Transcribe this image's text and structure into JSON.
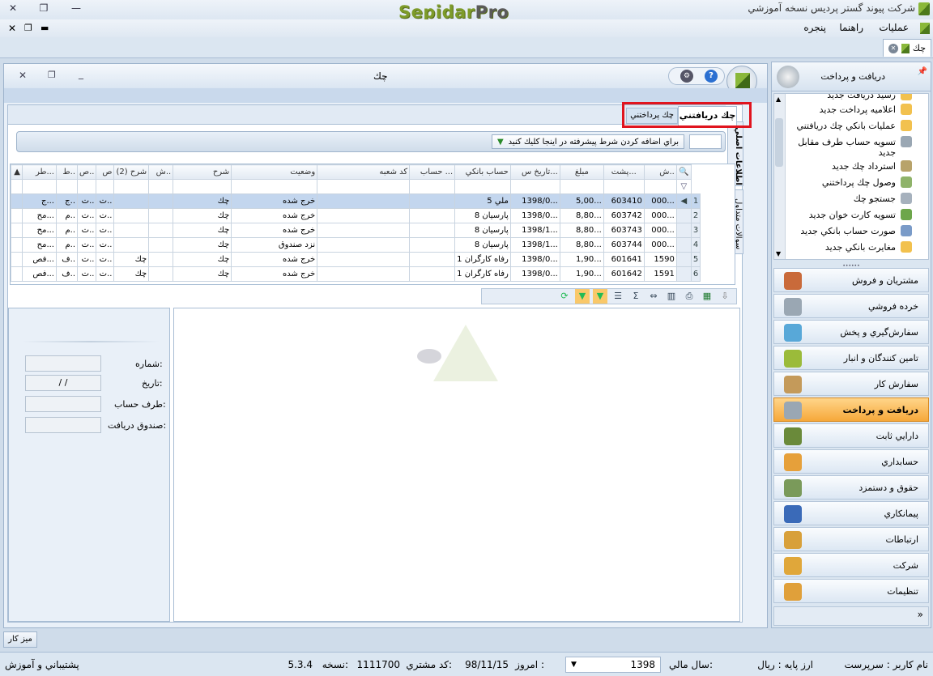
{
  "app": {
    "title": "شرکت پيوند گستر پرديس نسخه آموزشي",
    "logo_main": "Sepidar",
    "logo_pro": "Pro"
  },
  "menu": {
    "items": [
      "عمليات",
      "راهنما",
      "پنجره"
    ]
  },
  "doc_tab": {
    "label": "چك"
  },
  "window": {
    "title": "چك"
  },
  "tabs": {
    "received": "چك دريافتني",
    "payable": "چك پرداختني"
  },
  "side_tabs": [
    "اطلاعات اصلي",
    "سوالات متداول"
  ],
  "filter": {
    "hint": "براي اضافه كردن شرط پيشرفته در اينجا كليك كنيد"
  },
  "grid": {
    "columns": [
      "ش..",
      "پشت...",
      "مبلغ",
      "تاريخ س...",
      "حساب بانكي",
      "حساب ...",
      "كد شعبه",
      "وضعيت",
      "شرح",
      "ش..",
      "شرح (2)",
      "ص",
      "ص..",
      "ط..",
      "طر..."
    ],
    "rows": [
      [
        "1",
        "000...",
        "603410",
        "5,00...",
        "1398/0...",
        "ملي  5",
        "",
        "",
        "خرج شده",
        "چك",
        "",
        "",
        "ت..",
        "ت..",
        "ج..",
        "ج..."
      ],
      [
        "2",
        "000...",
        "603742",
        "8,80...",
        "1398/0...",
        "پارسيان  8",
        "",
        "",
        "خرج شده",
        "چك",
        "",
        "",
        "ت..",
        "ت..",
        "م..",
        "مح..."
      ],
      [
        "3",
        "000...",
        "603743",
        "8,80...",
        "1398/1...",
        "پارسيان  8",
        "",
        "",
        "خرج شده",
        "چك",
        "",
        "",
        "ت..",
        "ت..",
        "م..",
        "مح..."
      ],
      [
        "4",
        "000...",
        "603744",
        "8,80...",
        "1398/1...",
        "پارسيان  8",
        "",
        "",
        "نزد صندوق",
        "چك",
        "",
        "",
        "ت..",
        "ت..",
        "م..",
        "مح..."
      ],
      [
        "5",
        "1590",
        "601641",
        "1,90...",
        "1398/0...",
        "رفاه كارگران  1",
        "",
        "",
        "خرج شده",
        "چك",
        "",
        "چك",
        "ت..",
        "ت..",
        "ف..",
        "فص..."
      ],
      [
        "6",
        "1591",
        "601642",
        "1,90...",
        "1398/0...",
        "رفاه كارگران  1",
        "",
        "",
        "خرج شده",
        "چك",
        "",
        "چك",
        "ت..",
        "ت..",
        "ف..",
        "فص..."
      ]
    ]
  },
  "detail": {
    "number_label": "شماره:",
    "date_label": "تاريخ:",
    "date_value": "/  /",
    "party_label": "طرف حساب:",
    "box_label": "صندوق دريافت:"
  },
  "nav": {
    "header": "دريافت و پرداخت",
    "sub_items": [
      "رسيد دريافت جديد",
      "اعلاميه پرداخت جديد",
      "عمليات بانكي چك دريافتني",
      "تسويه حساب طرف مقابل",
      "جديد",
      "استرداد چك جديد",
      "وصول چك پرداختني",
      "جستجو چك",
      "تسويه كارت خوان جديد",
      "صورت حساب بانكي جديد",
      "مغايرت بانكي جديد"
    ],
    "modules": [
      "مشتريان و فروش",
      "خرده فروشي",
      "سفارش‌گيري و پخش",
      "تامين كنندگان و انبار",
      "سفارش كار",
      "دريافت و پرداخت",
      "دارايي ثابت",
      "حسابداري",
      "حقوق و دستمزد",
      "پيمانكاري",
      "ارتباطات",
      "شركت",
      "تنظيمات"
    ],
    "active_module": "دريافت و پرداخت"
  },
  "desk_button": "ميز كار",
  "status": {
    "user_label": "نام كاربر :",
    "user_value": "سرپرست",
    "currency_label": "ارز پايه :",
    "currency_value": "ريال",
    "fiscal_label": "سال مالي:",
    "fiscal_value": "1398",
    "today_label": "امروز :",
    "today_value": "98/11/15",
    "customer_label": "كد مشتري:",
    "customer_value": "1111700",
    "version_label": "نسخه:",
    "version_value": "5.3.4",
    "support": "پشتيباني و آموزش"
  },
  "colors": {
    "accent": "#f6a83a",
    "highlight": "#e0141e",
    "logo": "#7d9b2a"
  }
}
